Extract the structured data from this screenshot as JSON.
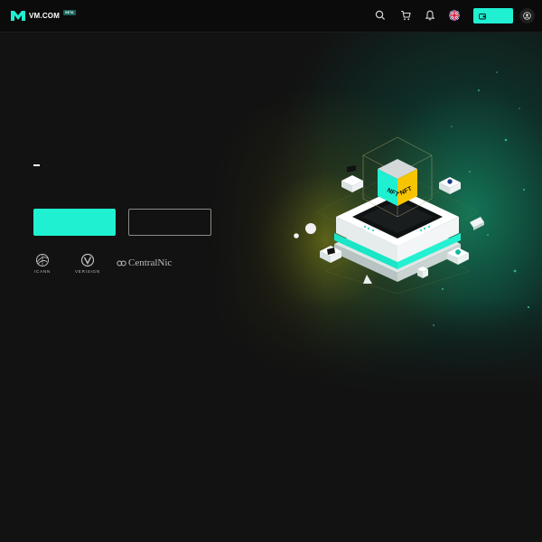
{
  "brand": {
    "name": "VM.COM",
    "badge": "BETA",
    "accent": "#1ff0d2"
  },
  "header": {
    "icons": [
      "search-icon",
      "cart-icon",
      "bell-icon",
      "uk-flag-icon",
      "wallet-icon",
      "user-icon"
    ]
  },
  "hero": {
    "cube_label_left": "NFT",
    "cube_label_right": "NFT"
  },
  "partners": [
    {
      "name": "ICANN",
      "icon": "icann-logo"
    },
    {
      "name": "VERISIGN",
      "icon": "verisign-logo"
    },
    {
      "name": "CentralNic",
      "icon": "centralnic-logo"
    }
  ]
}
